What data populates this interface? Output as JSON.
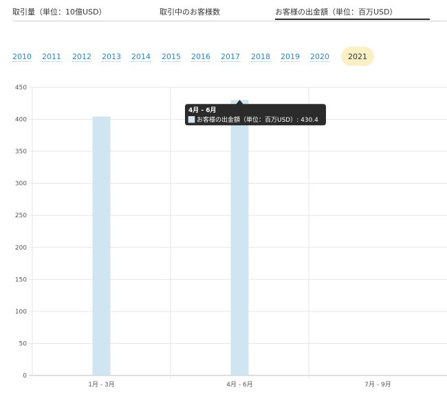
{
  "tabs": [
    {
      "label": "取引量（単位：10億USD）"
    },
    {
      "label": "取引中のお客様数"
    },
    {
      "label": "お客様の出金額（単位：百万USD）"
    }
  ],
  "years": [
    "2010",
    "2011",
    "2012",
    "2013",
    "2014",
    "2015",
    "2016",
    "2017",
    "2018",
    "2019",
    "2020"
  ],
  "active_year": "2021",
  "tooltip": {
    "title": "4月 - 6月",
    "text": "お客様の出金額（単位：百万USD）: 430.4"
  },
  "colors": {
    "bar": "#cfe5f1",
    "tooltip_bg": "#2b2b2b",
    "year_link": "#2a86c7",
    "active_year_bg": "#fbefc4"
  },
  "chart_data": {
    "type": "bar",
    "categories": [
      "1月 - 3月",
      "4月 - 6月",
      "7月 - 9月"
    ],
    "series": [
      {
        "name": "お客様の出金額（単位：百万USD）",
        "values": [
          404.5,
          430.4,
          null
        ]
      }
    ],
    "ylim": [
      0,
      450
    ],
    "yticks": [
      0,
      50,
      100,
      150,
      200,
      250,
      300,
      350,
      400,
      450
    ],
    "grid": true
  }
}
